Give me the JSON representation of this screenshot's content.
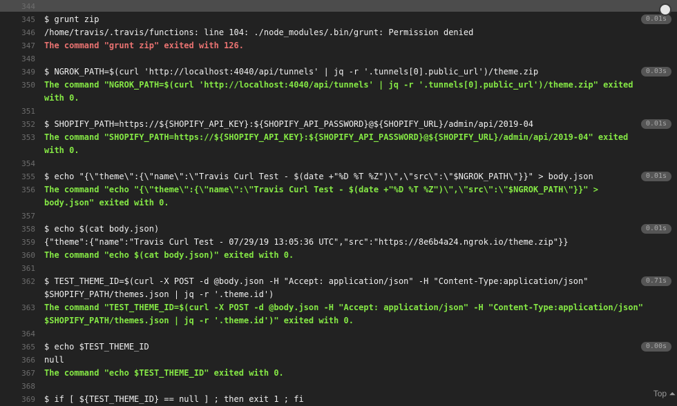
{
  "lines": [
    {
      "num": "344",
      "text": "",
      "kind": "blank",
      "time": ""
    },
    {
      "num": "345",
      "text": "$ grunt zip",
      "kind": "cmd",
      "time": "0.01s"
    },
    {
      "num": "346",
      "text": "/home/travis/.travis/functions: line 104: ./node_modules/.bin/grunt: Permission denied",
      "kind": "out",
      "time": ""
    },
    {
      "num": "347",
      "text": "The command \"grunt zip\" exited with 126.",
      "kind": "err",
      "time": ""
    },
    {
      "num": "348",
      "text": "",
      "kind": "blank",
      "time": ""
    },
    {
      "num": "349",
      "text": "$ NGROK_PATH=$(curl 'http://localhost:4040/api/tunnels' | jq -r '.tunnels[0].public_url')/theme.zip",
      "kind": "cmd",
      "time": "0.03s"
    },
    {
      "num": "350",
      "text": "The command \"NGROK_PATH=$(curl 'http://localhost:4040/api/tunnels' | jq -r '.tunnels[0].public_url')/theme.zip\" exited with 0.",
      "kind": "ok",
      "time": ""
    },
    {
      "num": "351",
      "text": "",
      "kind": "blank",
      "time": ""
    },
    {
      "num": "352",
      "text": "$ SHOPIFY_PATH=https://${SHOPIFY_API_KEY}:${SHOPIFY_API_PASSWORD}@${SHOPIFY_URL}/admin/api/2019-04",
      "kind": "cmd",
      "time": "0.01s"
    },
    {
      "num": "353",
      "text": "The command \"SHOPIFY_PATH=https://${SHOPIFY_API_KEY}:${SHOPIFY_API_PASSWORD}@${SHOPIFY_URL}/admin/api/2019-04\" exited with 0.",
      "kind": "ok",
      "time": ""
    },
    {
      "num": "354",
      "text": "",
      "kind": "blank",
      "time": ""
    },
    {
      "num": "355",
      "text": "$ echo \"{\\\"theme\\\":{\\\"name\\\":\\\"Travis Curl Test - $(date +\"%D %T %Z\")\\\",\\\"src\\\":\\\"$NGROK_PATH\\\"}}\" > body.json",
      "kind": "cmd",
      "time": "0.01s"
    },
    {
      "num": "356",
      "text": "The command \"echo \"{\\\"theme\\\":{\\\"name\\\":\\\"Travis Curl Test - $(date +\"%D %T %Z\")\\\",\\\"src\\\":\\\"$NGROK_PATH\\\"}}\" > body.json\" exited with 0.",
      "kind": "ok",
      "time": ""
    },
    {
      "num": "357",
      "text": "",
      "kind": "blank",
      "time": ""
    },
    {
      "num": "358",
      "text": "$ echo $(cat body.json)",
      "kind": "cmd",
      "time": "0.01s"
    },
    {
      "num": "359",
      "text": "{\"theme\":{\"name\":\"Travis Curl Test - 07/29/19 13:05:36 UTC\",\"src\":\"https://8e6b4a24.ngrok.io/theme.zip\"}}",
      "kind": "out",
      "time": ""
    },
    {
      "num": "360",
      "text": "The command \"echo $(cat body.json)\" exited with 0.",
      "kind": "ok",
      "time": ""
    },
    {
      "num": "361",
      "text": "",
      "kind": "blank",
      "time": ""
    },
    {
      "num": "362",
      "text": "$ TEST_THEME_ID=$(curl -X POST -d @body.json -H \"Accept: application/json\" -H \"Content-Type:application/json\" $SHOPIFY_PATH/themes.json | jq -r '.theme.id')",
      "kind": "cmd",
      "time": "0.71s"
    },
    {
      "num": "363",
      "text": "The command \"TEST_THEME_ID=$(curl -X POST -d @body.json -H \"Accept: application/json\" -H \"Content-Type:application/json\" $SHOPIFY_PATH/themes.json | jq -r '.theme.id')\" exited with 0.",
      "kind": "ok",
      "time": ""
    },
    {
      "num": "364",
      "text": "",
      "kind": "blank",
      "time": ""
    },
    {
      "num": "365",
      "text": "$ echo $TEST_THEME_ID",
      "kind": "cmd",
      "time": "0.00s"
    },
    {
      "num": "366",
      "text": "null",
      "kind": "out",
      "time": ""
    },
    {
      "num": "367",
      "text": "The command \"echo $TEST_THEME_ID\" exited with 0.",
      "kind": "ok",
      "time": ""
    },
    {
      "num": "368",
      "text": "",
      "kind": "blank",
      "time": ""
    },
    {
      "num": "369",
      "text": "$ if [ ${TEST_THEME_ID} == null ] ; then exit 1 ; fi",
      "kind": "cmd",
      "time": ""
    }
  ],
  "footer": {
    "top_label": "Top ⏶"
  }
}
